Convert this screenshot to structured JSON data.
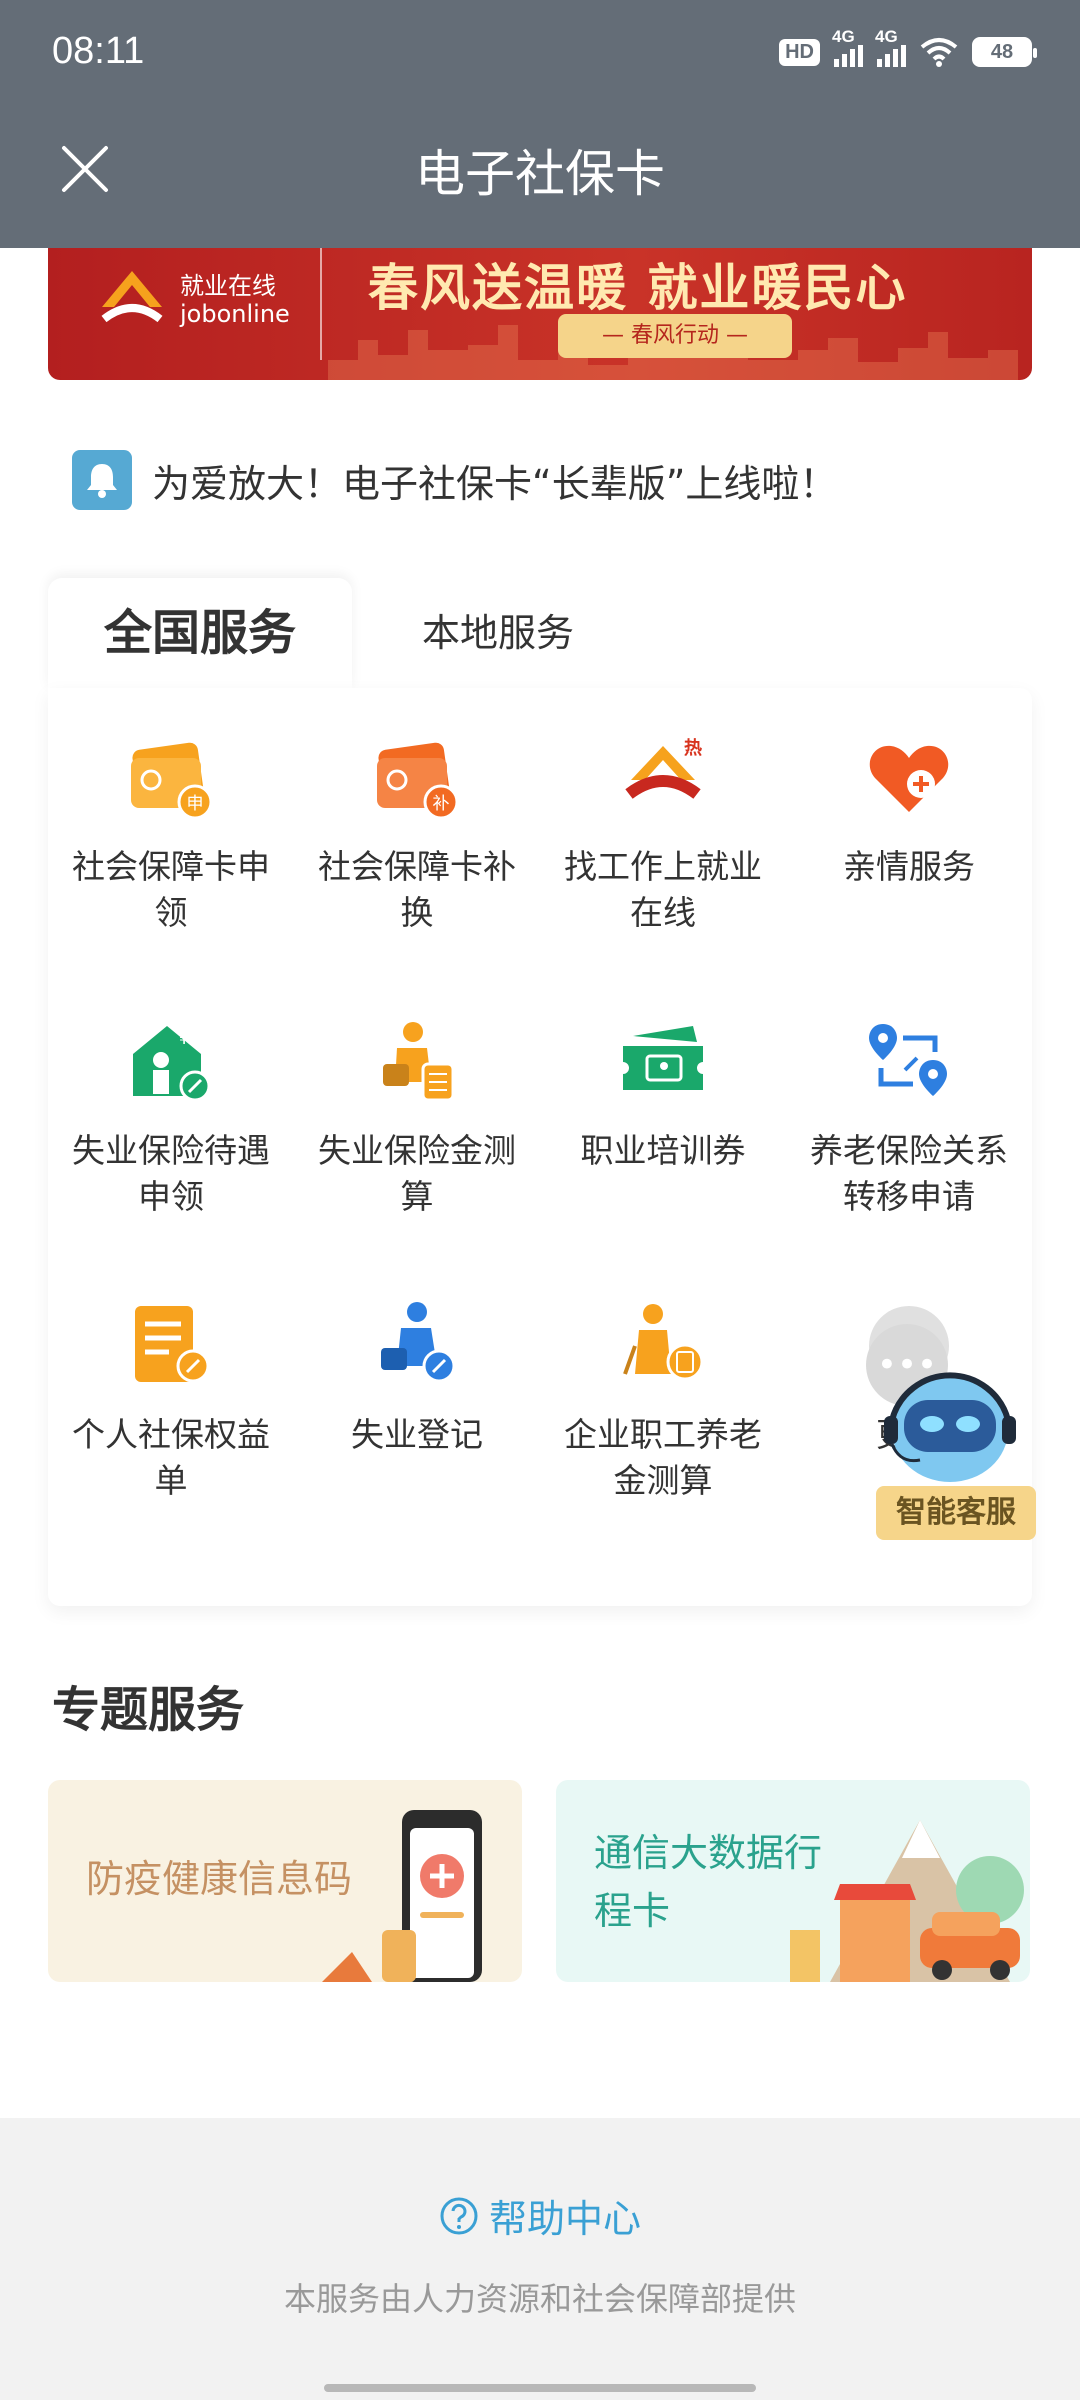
{
  "status_bar": {
    "time": "08:11",
    "hd_label": "HD",
    "signal1_label": "4G",
    "signal2_label": "4G",
    "battery": "48"
  },
  "header": {
    "title": "电子社保卡",
    "close_icon": "close-icon"
  },
  "banner": {
    "logo_line1": "就业在线",
    "logo_line2": "jobonline",
    "slogan": "春风送温暖 就业暖民心",
    "pill": "— 春风行动 —"
  },
  "notice": {
    "text": "为爱放大！电子社保卡“长辈版”上线啦！",
    "icon": "bell-icon"
  },
  "tabs": {
    "active": "全国服务",
    "inactive": "本地服务"
  },
  "services": [
    {
      "label": "社会保障卡申领",
      "icon": "card-apply-icon",
      "color": "#f7a21e"
    },
    {
      "label": "社会保障卡补换",
      "icon": "card-replace-icon",
      "color": "#f26a22"
    },
    {
      "label": "找工作上就业在线",
      "icon": "job-online-icon",
      "color": "#d8341f"
    },
    {
      "label": "亲情服务",
      "icon": "heart-plus-icon",
      "color": "#f15a24"
    },
    {
      "label": "失业保险待遇申领",
      "icon": "unemployment-benefit-icon",
      "color": "#1aa86b"
    },
    {
      "label": "失业保险金测算",
      "icon": "unemployment-calc-icon",
      "color": "#f7a21e"
    },
    {
      "label": "职业培训券",
      "icon": "training-voucher-icon",
      "color": "#1aa86b"
    },
    {
      "label": "养老保险关系转移申请",
      "icon": "pension-transfer-icon",
      "color": "#2e7fe0"
    },
    {
      "label": "个人社保权益单",
      "icon": "rights-doc-icon",
      "color": "#f7a21e"
    },
    {
      "label": "失业登记",
      "icon": "unemployment-register-icon",
      "color": "#2e7fe0"
    },
    {
      "label": "企业职工养老金测算",
      "icon": "pension-calc-icon",
      "color": "#f7a21e"
    },
    {
      "label": "更多",
      "icon": "more-icon",
      "color": "#cccccc"
    }
  ],
  "assistant": {
    "label": "智能客服",
    "more_glyph": "•••"
  },
  "topic_section": {
    "title": "专题服务",
    "items": [
      {
        "title": "防疫健康信息码"
      },
      {
        "title": "通信大数据行程卡"
      }
    ]
  },
  "footer": {
    "help": "帮助中心",
    "provider": "本服务由人力资源和社会保障部提供"
  }
}
